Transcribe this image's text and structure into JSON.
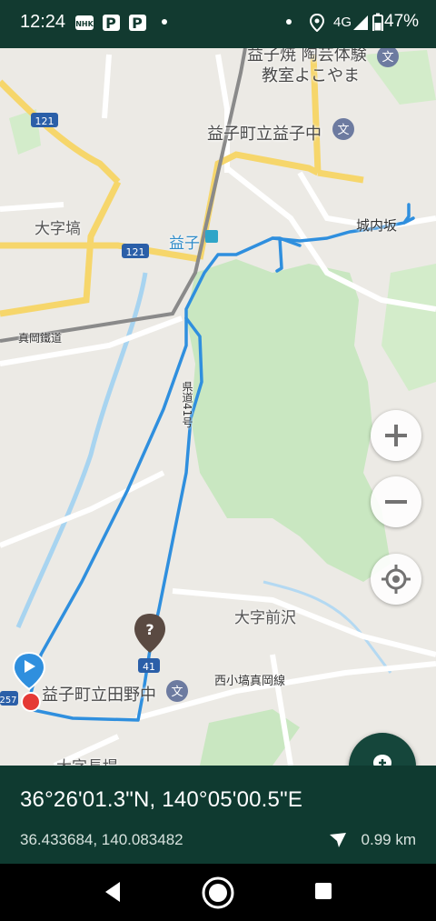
{
  "status_bar": {
    "time": "12:24",
    "network": "4G",
    "battery": "47%",
    "icons": [
      "nhk-icon",
      "paypay-icon",
      "paypay-icon",
      "location-icon",
      "signal-icon",
      "battery-icon"
    ]
  },
  "map": {
    "labels": {
      "pottery": "益子焼 陶芸体験",
      "pottery2": "教室よこやま",
      "mashiko_jhs": "益子町立益子中",
      "oaza_hashi": "大字塙",
      "mashiko_station": "益子",
      "jonaizaka": "城内坂",
      "moka_rail": "真岡鐵道",
      "route_vertical": "県道41号",
      "oaza_maezawa": "大字前沢",
      "tano_jhs": "益子町立田野中",
      "nishikohashi": "西小塙真岡線",
      "oaza_nagatsutsumi": "大字長堤",
      "road121_a": "121",
      "road121_b": "121",
      "road41": "41",
      "road257": "257"
    },
    "colors": {
      "route": "#2f8fde",
      "yellow_road": "#f6d66b",
      "park": "#c9e7c1",
      "rail": "#888888"
    }
  },
  "controls": {
    "zoom_in": "+",
    "zoom_out": "−",
    "locate": "crosshair-icon",
    "add_pin": "pin-plus-icon"
  },
  "info": {
    "dms": "36°26'01.3\"N, 140°05'00.5\"E",
    "decimal": "36.433684, 140.083482",
    "distance": "0.99 km"
  },
  "nav": {
    "back": "back-icon",
    "home": "home-icon",
    "recents": "recents-icon"
  }
}
